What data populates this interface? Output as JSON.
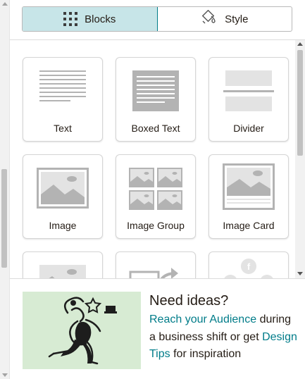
{
  "tabs": {
    "blocks_label": "Blocks",
    "style_label": "Style"
  },
  "blocks": [
    {
      "label": "Text",
      "icon": "text-block-icon"
    },
    {
      "label": "Boxed Text",
      "icon": "boxed-text-block-icon"
    },
    {
      "label": "Divider",
      "icon": "divider-block-icon"
    },
    {
      "label": "Image",
      "icon": "image-block-icon"
    },
    {
      "label": "Image Group",
      "icon": "image-group-block-icon"
    },
    {
      "label": "Image Card",
      "icon": "image-card-block-icon"
    }
  ],
  "ideas": {
    "title": "Need ideas?",
    "link1": "Reach your Audience",
    "text1": "during a business shift or get",
    "link2": "Design Tips",
    "text2": "for inspiration"
  },
  "colors": {
    "accent": "#007c89",
    "active_tab_bg": "#c7e5e8",
    "illustration_bg": "#d7ebd3"
  }
}
